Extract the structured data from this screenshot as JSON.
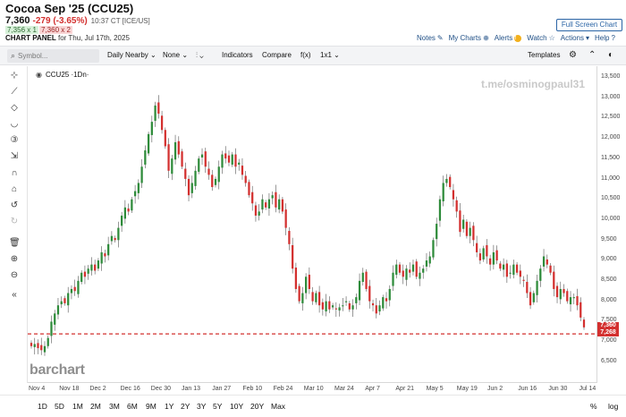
{
  "header": {
    "title": "Cocoa Sep '25 (CCU25)",
    "price": "7,360",
    "change": "-279 (-3.65%)",
    "time": "10:37 CT [ICE/US]",
    "bid": "7,356 x 1",
    "ask": "7,360 x 2",
    "panel_label": "CHART PANEL",
    "panel_date": "for Thu, Jul 17th, 2025",
    "fullscreen_label": "Full Screen Chart",
    "links": {
      "notes": "Notes",
      "mycharts": "My Charts",
      "alerts": "Alerts",
      "watch": "Watch",
      "actions": "Actions",
      "help": "Help"
    }
  },
  "toolbar": {
    "search_placeholder": "Symbol...",
    "interval": "Daily Nearby",
    "none": "None",
    "indicators": "Indicators",
    "compare": "Compare",
    "fx": "f(x)",
    "layout": "1x1",
    "templates": "Templates"
  },
  "chart": {
    "symbol_label": "CCU25 ·1Dn·",
    "watermark": "t.me/osminogpaul31",
    "logo": "barchart",
    "last_price_label": "7,360",
    "last_price_sub": "7,268",
    "y_ticks": [
      "13,500",
      "13,000",
      "12,500",
      "12,000",
      "11,500",
      "11,000",
      "10,500",
      "10,000",
      "9,500",
      "9,000",
      "8,500",
      "8,000",
      "7,500",
      "7,000",
      "6,500"
    ],
    "x_ticks": [
      "Nov 4",
      "Nov 18",
      "Dec 2",
      "Dec 16",
      "Dec 30",
      "Jan 13",
      "Jan 27",
      "Feb 10",
      "Feb 24",
      "Mar 10",
      "Mar 24",
      "Apr 7",
      "Apr 21",
      "May 5",
      "May 19",
      "Jun 2",
      "Jun 16",
      "Jun 30",
      "Jul 14"
    ]
  },
  "colors": {
    "up": "#2e8b3a",
    "down": "#d3302f",
    "accent": "#1f4f86",
    "price_line": "#d3302f"
  },
  "chart_data": {
    "type": "candlestick",
    "title": "Cocoa Sep '25 (CCU25)",
    "ylim": [
      6300,
      13600
    ],
    "reference_line": 7200,
    "last_price": 7360,
    "closes": [
      6900,
      6950,
      6850,
      6800,
      6900,
      7100,
      7500,
      7700,
      7900,
      8000,
      7950,
      8200,
      8300,
      8250,
      8500,
      8700,
      8600,
      8800,
      8900,
      8750,
      9000,
      9200,
      9100,
      9400,
      9600,
      9500,
      9800,
      10100,
      10300,
      10200,
      10500,
      10700,
      10900,
      11300,
      11700,
      12100,
      12400,
      12800,
      12600,
      12200,
      11800,
      11200,
      11500,
      11900,
      11600,
      11300,
      11000,
      10600,
      10900,
      11200,
      11500,
      11600,
      11300,
      11100,
      10800,
      11000,
      11300,
      11600,
      11500,
      11400,
      11600,
      11300,
      11400,
      11100,
      10900,
      10600,
      10400,
      10100,
      10200,
      10500,
      10300,
      10500,
      10600,
      10300,
      10500,
      10200,
      9800,
      9400,
      8800,
      8300,
      8000,
      8200,
      8600,
      8300,
      8000,
      8200,
      7900,
      7800,
      8000,
      7800,
      7900,
      7800,
      7850,
      7900,
      8000,
      7800,
      7900,
      8100,
      8500,
      8700,
      8300,
      8000,
      7900,
      7700,
      7900,
      8100,
      8000,
      8300,
      8700,
      8900,
      8700,
      8600,
      8800,
      8700,
      8900,
      8600,
      8700,
      8800,
      9000,
      9100,
      9500,
      9900,
      10500,
      10900,
      11000,
      10800,
      10500,
      10200,
      9700,
      10000,
      9600,
      9800,
      9500,
      9200,
      9000,
      9300,
      9100,
      8900,
      9200,
      9000,
      8800,
      8900,
      8600,
      8700,
      8900,
      8700,
      8600,
      8500,
      8200,
      7900,
      8200,
      8500,
      8800,
      9100,
      8900,
      8700,
      8300,
      8100,
      8300,
      8200,
      8000,
      8100,
      8100,
      7900,
      7600,
      7360
    ]
  }
}
